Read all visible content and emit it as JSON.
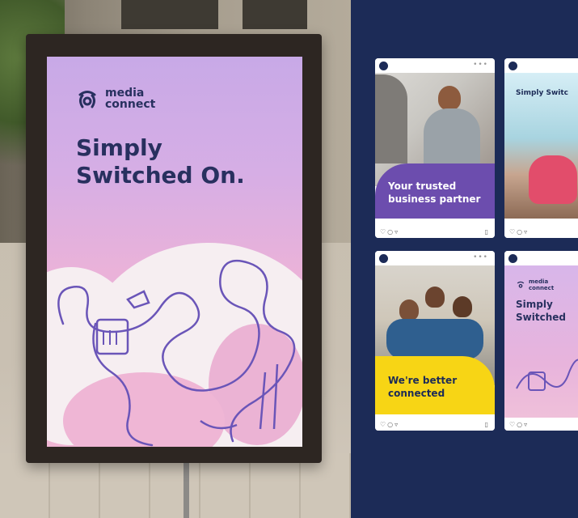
{
  "poster": {
    "logo_line1": "media",
    "logo_line2": "connect",
    "headline_line1": "Simply",
    "headline_line2": "Switched On."
  },
  "social_cards": [
    {
      "caption_line1": "Your trusted",
      "caption_line2": "business partner"
    },
    {
      "caption": "Simply Switc"
    },
    {
      "caption_line1": "We're better",
      "caption_line2": "connected"
    },
    {
      "logo_line1": "media",
      "logo_line2": "connect",
      "headline_line1": "Simply",
      "headline_line2": "Switched"
    }
  ],
  "colors": {
    "navy": "#1c2b57",
    "purple": "#6c4dae",
    "yellow": "#f7d515",
    "pink": "#efb6d4",
    "lavender": "#c8a9e7"
  },
  "icons": [
    "media-connect-logo-icon",
    "heart-icon",
    "comment-icon",
    "share-icon",
    "bookmark-icon",
    "more-dots-icon"
  ]
}
